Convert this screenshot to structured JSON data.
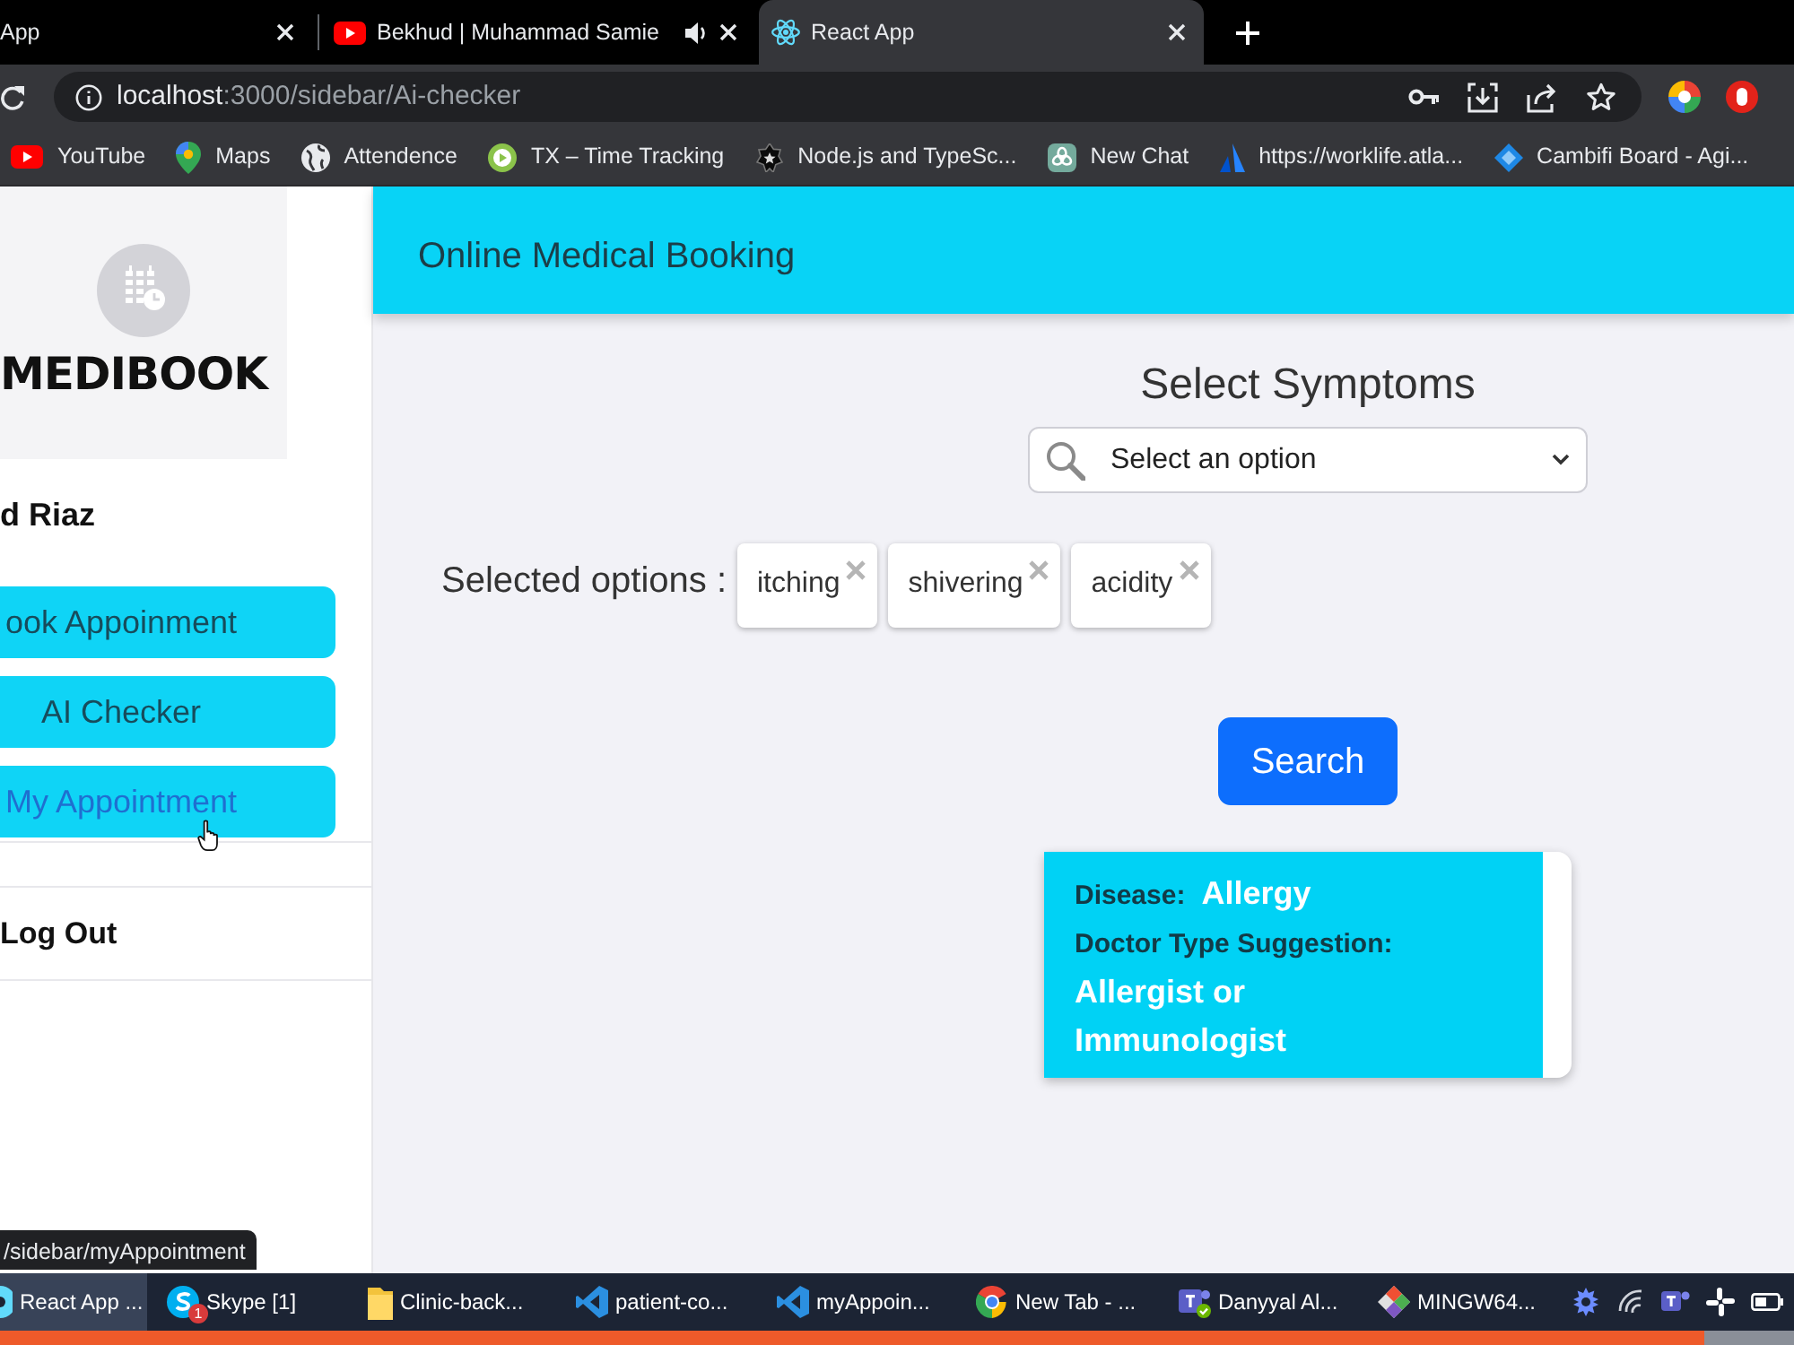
{
  "browser": {
    "tabs": [
      {
        "title": "App",
        "selected": false,
        "audio": false
      },
      {
        "title": "Bekhud | Muhammad Samie",
        "selected": false,
        "audio": true
      },
      {
        "title": "React App",
        "selected": true,
        "audio": false
      }
    ],
    "address": {
      "host": "localhost",
      "path": ":3000/sidebar/Ai-checker"
    },
    "bookmarks": [
      "YouTube",
      "Maps",
      "Attendence",
      "TX – Time Tracking",
      "Node.js and TypeSc...",
      "New Chat",
      "https://worklife.atla...",
      "Cambifi Board - Agi..."
    ]
  },
  "sidebar": {
    "logo": "MEDIBOOK",
    "user": "d Riaz",
    "nav": [
      {
        "label": "ook Appoinment",
        "hovered": false
      },
      {
        "label": "AI Checker",
        "hovered": false
      },
      {
        "label": "My Appointment",
        "hovered": true
      }
    ],
    "logout": "Log Out"
  },
  "header": {
    "title": "Online Medical Booking"
  },
  "symptoms": {
    "heading": "Select Symptoms",
    "select": {
      "placeholder": "Select an option"
    },
    "selected_label": "Selected options :",
    "chips": [
      "itching",
      "shivering",
      "acidity"
    ],
    "search_button": "Search"
  },
  "result": {
    "disease_label": "Disease:",
    "disease": "Allergy",
    "doctor_label": "Doctor Type Suggestion:",
    "doctor": "Allergist or Immunologist"
  },
  "link_preview": "/sidebar/myAppointment",
  "taskbar": {
    "items": [
      {
        "label": "React App ...",
        "selected": true
      },
      {
        "label": "Skype [1]",
        "selected": false,
        "badge": "1"
      },
      {
        "label": "Clinic-back...",
        "selected": false
      },
      {
        "label": "patient-co...",
        "selected": false
      },
      {
        "label": "myAppoin...",
        "selected": false
      },
      {
        "label": "New Tab - ...",
        "selected": false
      },
      {
        "label": "Danyyal Al...",
        "selected": false
      },
      {
        "label": "MINGW64...",
        "selected": false
      }
    ]
  }
}
